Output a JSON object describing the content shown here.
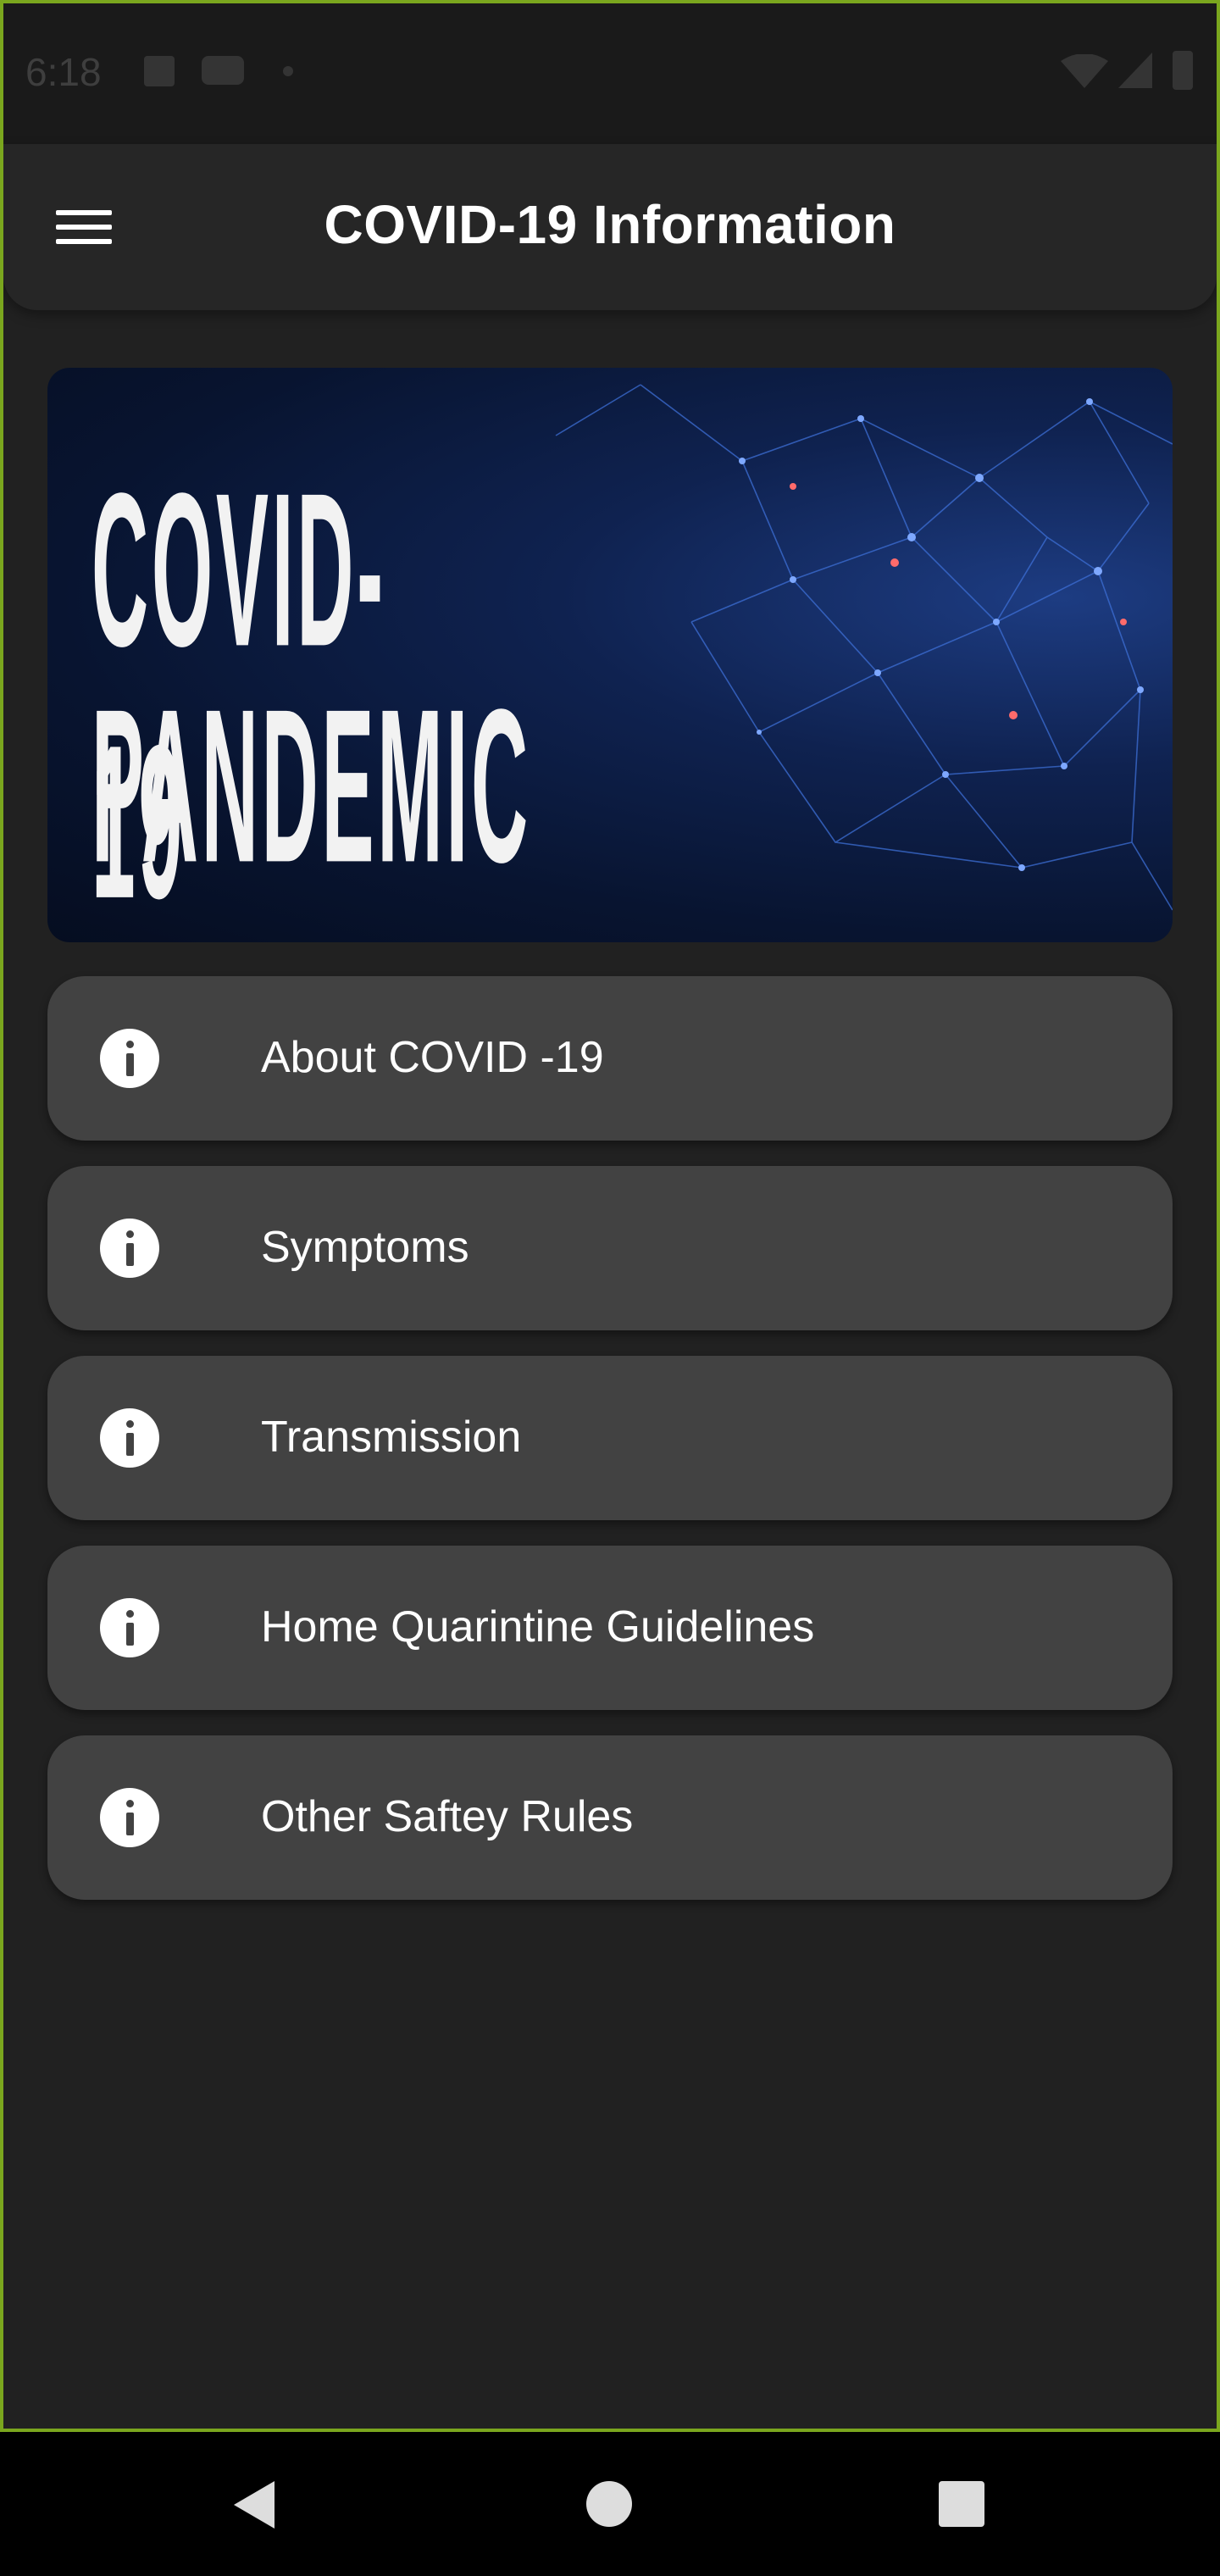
{
  "status_bar": {
    "time": "6:18",
    "icons": [
      "a-notification-icon",
      "youtube-icon",
      "dot-icon",
      "wifi-icon",
      "signal-icon",
      "battery-icon"
    ]
  },
  "app_bar": {
    "title": "COVID-19 Information",
    "menu_icon": "hamburger-menu-icon"
  },
  "banner": {
    "line1": "COVID-19",
    "line2": "PANDEMIC"
  },
  "menu": {
    "items": [
      {
        "label": "About COVID -19",
        "icon": "info-icon"
      },
      {
        "label": "Symptoms",
        "icon": "info-icon"
      },
      {
        "label": "Transmission",
        "icon": "info-icon"
      },
      {
        "label": "Home Quarintine Guidelines",
        "icon": "info-icon"
      },
      {
        "label": "Other Saftey Rules",
        "icon": "info-icon"
      }
    ]
  },
  "nav_bar": {
    "buttons": [
      "back-icon",
      "home-icon",
      "recents-icon"
    ]
  },
  "colors": {
    "background": "#212121",
    "card": "#424242",
    "app_bar": "#262626",
    "frame_border": "#7aa61e",
    "text": "#ffffff"
  }
}
